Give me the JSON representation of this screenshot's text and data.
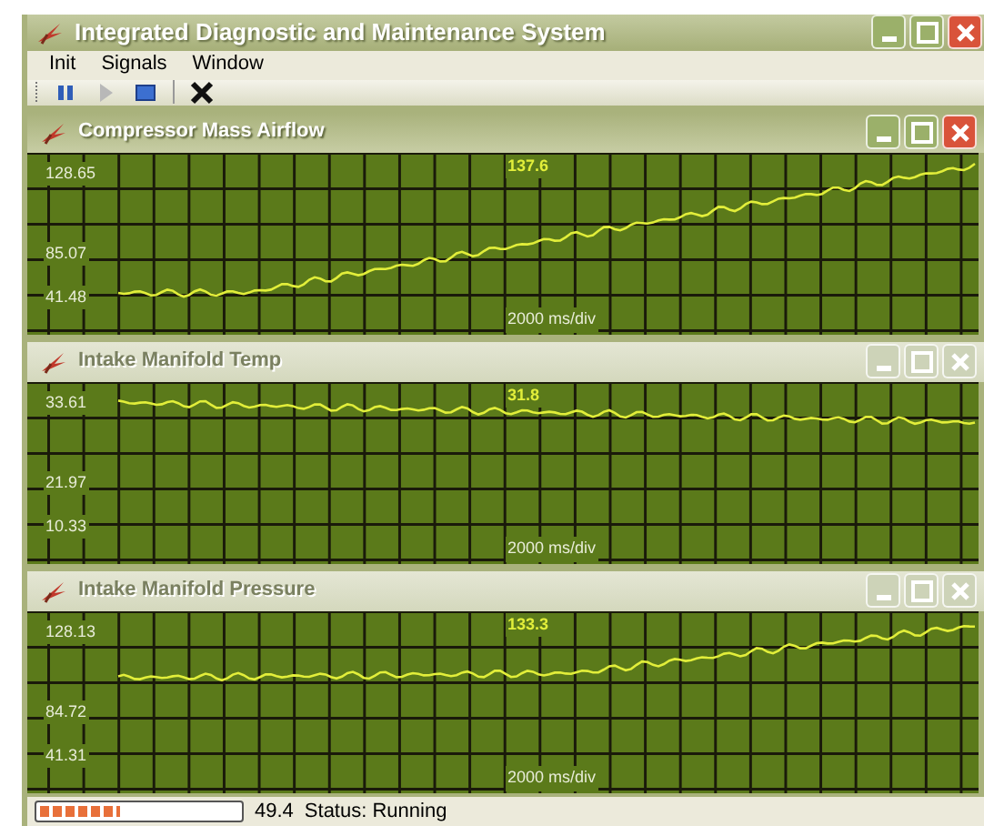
{
  "window": {
    "title": "Integrated Diagnostic and Maintenance System"
  },
  "menu": [
    "Init",
    "Signals",
    "Window"
  ],
  "toolbar": [
    {
      "kind": "pause",
      "disabled": false
    },
    {
      "kind": "play",
      "disabled": true
    },
    {
      "kind": "stop",
      "disabled": false
    },
    {
      "kind": "separator"
    },
    {
      "kind": "close",
      "disabled": false
    }
  ],
  "panels": [
    {
      "title": "Compressor Mass Airflow",
      "active": true,
      "y_labels": [
        "128.65",
        "85.07",
        "41.48"
      ],
      "readout": "137.6",
      "time_scale": "2000 ms/div"
    },
    {
      "title": "Intake Manifold Temp",
      "active": false,
      "y_labels": [
        "33.61",
        "21.97",
        "10.33"
      ],
      "readout": "31.8",
      "time_scale": "2000 ms/div"
    },
    {
      "title": "Intake Manifold Pressure",
      "active": false,
      "y_labels": [
        "128.13",
        "84.72",
        "41.31"
      ],
      "readout": "133.3",
      "time_scale": "2000 ms/div"
    }
  ],
  "status_bar": {
    "progress": {
      "level": 0.4
    },
    "value": "49.4",
    "status": "Status: Running"
  }
}
